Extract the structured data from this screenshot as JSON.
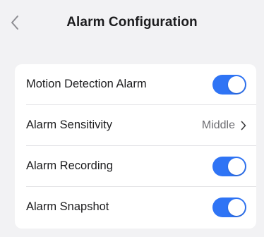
{
  "header": {
    "title": "Alarm Configuration",
    "back_icon": "chevron-left-icon"
  },
  "settings": {
    "motion_detection": {
      "label": "Motion Detection Alarm",
      "enabled": true
    },
    "sensitivity": {
      "label": "Alarm Sensitivity",
      "value": "Middle",
      "icon": "chevron-right-icon"
    },
    "recording": {
      "label": "Alarm Recording",
      "enabled": true
    },
    "snapshot": {
      "label": "Alarm Snapshot",
      "enabled": true
    }
  },
  "colors": {
    "accent": "#2f74f5",
    "background": "#f2f2f4",
    "card": "#ffffff"
  }
}
